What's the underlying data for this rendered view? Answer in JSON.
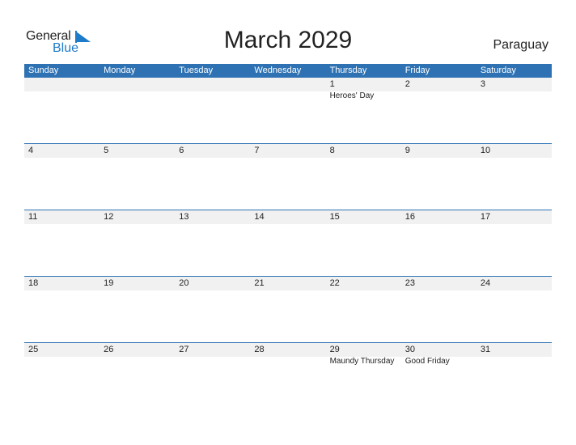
{
  "logo": {
    "general": "General",
    "blue": "Blue"
  },
  "title": "March 2029",
  "country": "Paraguay",
  "weekdays": [
    "Sunday",
    "Monday",
    "Tuesday",
    "Wednesday",
    "Thursday",
    "Friday",
    "Saturday"
  ],
  "weeks": [
    {
      "days": [
        "",
        "",
        "",
        "",
        "1",
        "2",
        "3"
      ],
      "events": [
        "",
        "",
        "",
        "",
        "Heroes' Day",
        "",
        ""
      ]
    },
    {
      "days": [
        "4",
        "5",
        "6",
        "7",
        "8",
        "9",
        "10"
      ],
      "events": [
        "",
        "",
        "",
        "",
        "",
        "",
        ""
      ]
    },
    {
      "days": [
        "11",
        "12",
        "13",
        "14",
        "15",
        "16",
        "17"
      ],
      "events": [
        "",
        "",
        "",
        "",
        "",
        "",
        ""
      ]
    },
    {
      "days": [
        "18",
        "19",
        "20",
        "21",
        "22",
        "23",
        "24"
      ],
      "events": [
        "",
        "",
        "",
        "",
        "",
        "",
        ""
      ]
    },
    {
      "days": [
        "25",
        "26",
        "27",
        "28",
        "29",
        "30",
        "31"
      ],
      "events": [
        "",
        "",
        "",
        "",
        "Maundy Thursday",
        "Good Friday",
        ""
      ]
    }
  ],
  "colors": {
    "header": "#2e72b3",
    "brand_blue": "#1e7bc8",
    "day_row": "#f1f1f1"
  }
}
